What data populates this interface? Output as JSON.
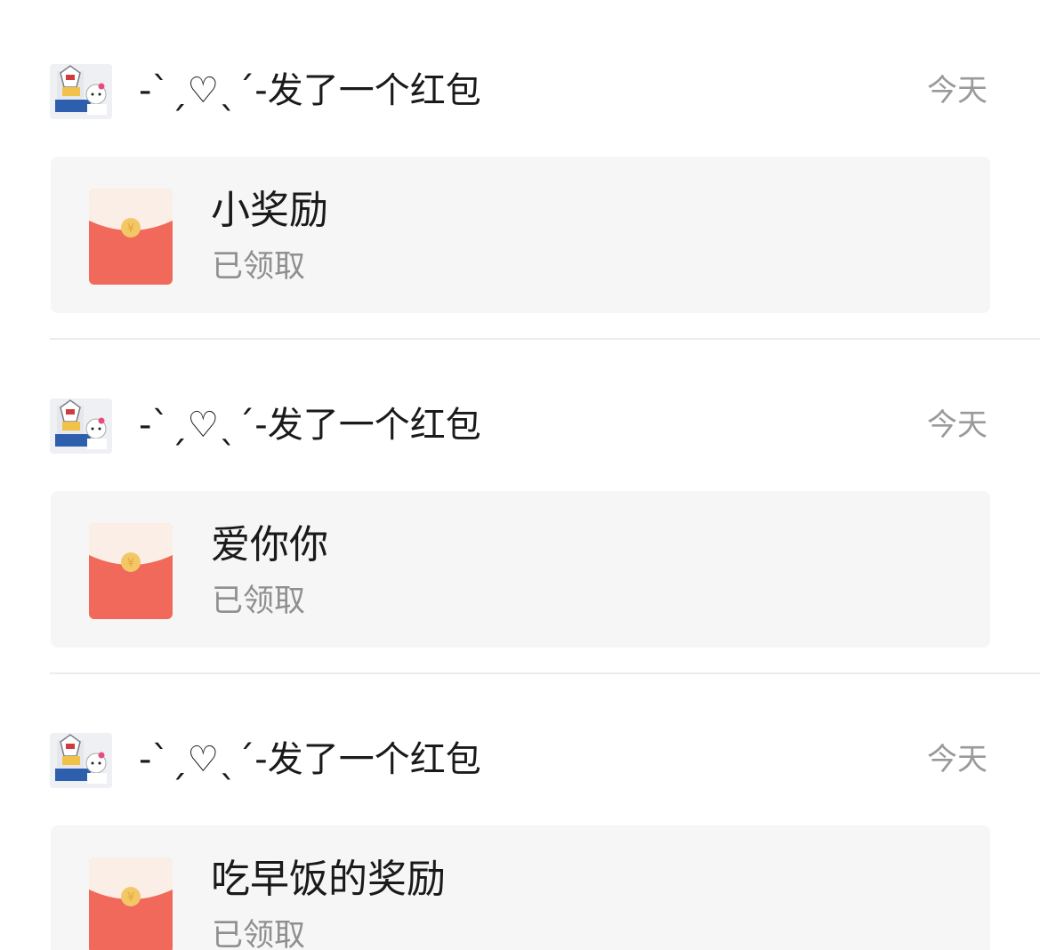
{
  "entries": [
    {
      "sender_line": "-ˋˏ♡ˎˊ-发了一个红包",
      "time": "今天",
      "card_title": "小奖励",
      "card_status": "已领取"
    },
    {
      "sender_line": "-ˋˏ♡ˎˊ-发了一个红包",
      "time": "今天",
      "card_title": "爱你你",
      "card_status": "已领取"
    },
    {
      "sender_line": "-ˋˏ♡ˎˊ-发了一个红包",
      "time": "今天",
      "card_title": "吃早饭的奖励",
      "card_status": "已领取"
    }
  ],
  "colors": {
    "envelope_body": "#f1695a",
    "envelope_flap": "#fbeee6",
    "envelope_coin": "#f4c766",
    "card_background": "#f6f6f6",
    "divider": "#ececec"
  },
  "icons": {
    "avatar": "robot-and-kitty-avatar-icon",
    "envelope": "red-envelope-icon"
  }
}
